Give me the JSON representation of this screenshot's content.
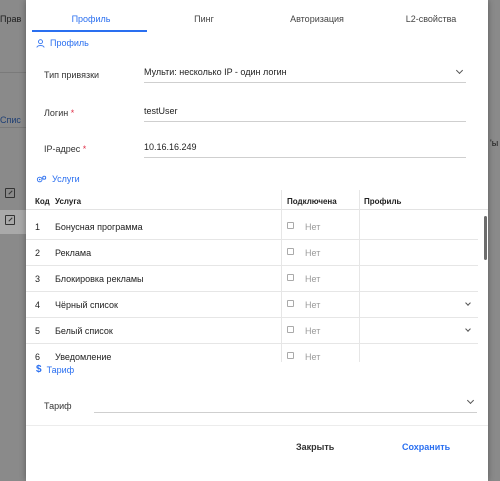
{
  "background": {
    "top_label": "Прав",
    "side_link": "Спис",
    "right_fragment": "'ы"
  },
  "tabs": [
    {
      "label": "Профиль",
      "active": true
    },
    {
      "label": "Пинг",
      "active": false
    },
    {
      "label": "Авторизация",
      "active": false
    },
    {
      "label": "L2-свойства",
      "active": false
    }
  ],
  "profile_section": {
    "title": "Профиль",
    "binding_type": {
      "label": "Тип привязки",
      "value": "Мульти: несколько IP - один логин"
    },
    "login": {
      "label": "Логин",
      "required_mark": "*",
      "value": "testUser"
    },
    "ip": {
      "label": "IP-адрес",
      "required_mark": "*",
      "value": "10.16.16.249"
    }
  },
  "services_section": {
    "title": "Услуги",
    "columns": [
      "Код",
      "Услуга",
      "Подключена",
      "Профиль"
    ],
    "rows": [
      {
        "code": "1",
        "name": "Бонусная программа",
        "connected": "Нет",
        "has_dropdown": false
      },
      {
        "code": "2",
        "name": "Реклама",
        "connected": "Нет",
        "has_dropdown": false
      },
      {
        "code": "3",
        "name": "Блокировка рекламы",
        "connected": "Нет",
        "has_dropdown": false
      },
      {
        "code": "4",
        "name": "Чёрный список",
        "connected": "Нет",
        "has_dropdown": true
      },
      {
        "code": "5",
        "name": "Белый список",
        "connected": "Нет",
        "has_dropdown": true
      },
      {
        "code": "6",
        "name": "Уведомление",
        "connected": "Нет",
        "has_dropdown": false
      }
    ]
  },
  "tariff_section": {
    "title": "Тариф",
    "field_label": "Тариф",
    "value": ""
  },
  "footer": {
    "close_label": "Закрыть",
    "save_label": "Сохранить"
  },
  "colors": {
    "accent": "#2a6ff0",
    "required": "#e0334b"
  }
}
